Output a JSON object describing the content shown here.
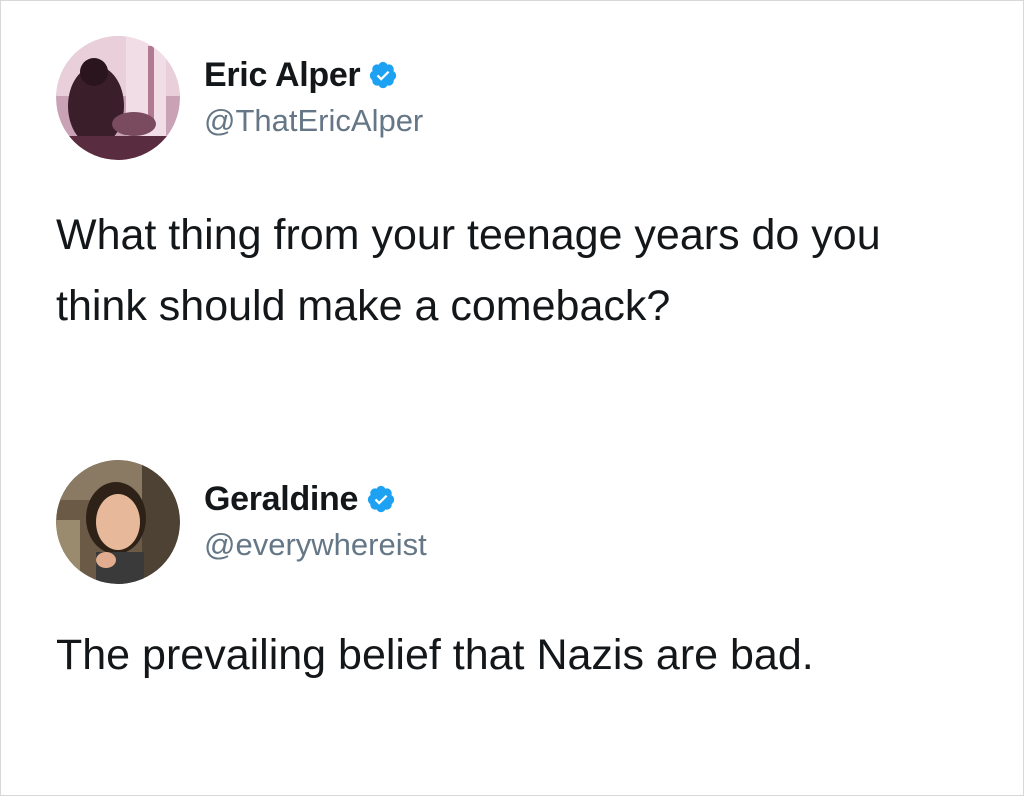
{
  "tweets": [
    {
      "display_name": "Eric Alper",
      "handle": "@ThatEricAlper",
      "verified": true,
      "avatar_icon": "profile-photo-icon",
      "text": "What thing from your teenage years do you think should make a comeback?"
    },
    {
      "display_name": "Geraldine",
      "handle": "@everywhereist",
      "verified": true,
      "avatar_icon": "profile-photo-icon",
      "text": "The prevailing belief that Nazis are bad."
    }
  ],
  "colors": {
    "text": "#14171a",
    "handle": "#657786",
    "verified_badge": "#1da1f2",
    "background": "#ffffff"
  }
}
